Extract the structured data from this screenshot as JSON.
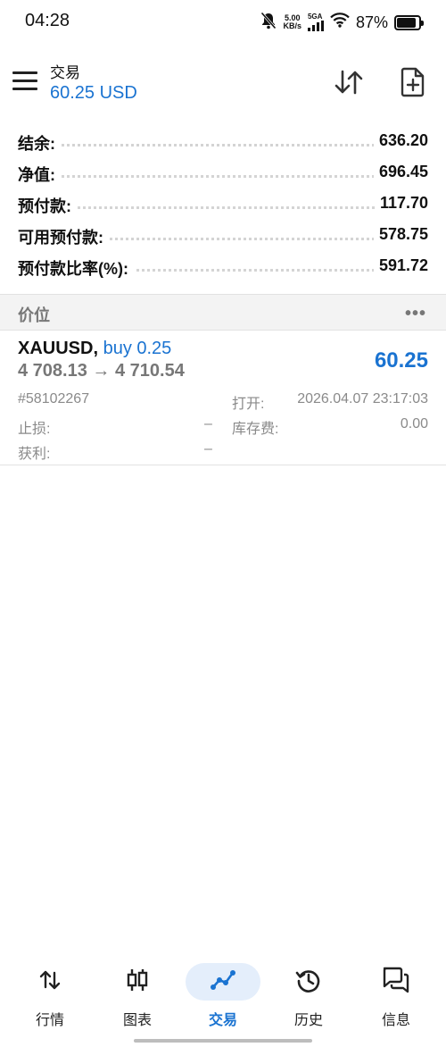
{
  "status": {
    "time": "04:28",
    "speed_value": "5.00",
    "speed_unit": "KB/s",
    "network": "5GA",
    "battery_pct": "87%",
    "battery_level": 0.87,
    "icons": [
      "mute-bell-icon",
      "signal-icon",
      "wifi-icon",
      "battery-icon"
    ]
  },
  "header": {
    "title": "交易",
    "balance": "60.25 USD",
    "icons": [
      "menu-icon",
      "sort-icon",
      "new-order-icon"
    ]
  },
  "summary": [
    {
      "label": "结余:",
      "value": "636.20"
    },
    {
      "label": "净值:",
      "value": "696.45"
    },
    {
      "label": "预付款:",
      "value": "117.70"
    },
    {
      "label": "可用预付款:",
      "value": "578.75"
    },
    {
      "label": "预付款比率(%):",
      "value": "591.72"
    }
  ],
  "section": {
    "title": "价位",
    "more": "•••"
  },
  "position": {
    "symbol": "XAUUSD,",
    "side": "buy 0.25",
    "prices": "4 708.13 → 4 710.54",
    "profit": "60.25",
    "ticket": "#58102267",
    "open_label": "打开:",
    "open_time": "2026.04.07 23:17:03",
    "sl_label": "止损:",
    "sl_value": "–",
    "swap_label": "库存费:",
    "swap_value": "0.00",
    "tp_label": "获利:",
    "tp_value": "–"
  },
  "nav": {
    "items": [
      {
        "label": "行情",
        "icon": "quotes-icon"
      },
      {
        "label": "图表",
        "icon": "chart-icon"
      },
      {
        "label": "交易",
        "icon": "trade-icon"
      },
      {
        "label": "历史",
        "icon": "history-icon"
      },
      {
        "label": "信息",
        "icon": "messages-icon"
      }
    ],
    "active": "交易",
    "accent": "#1a73d1"
  }
}
